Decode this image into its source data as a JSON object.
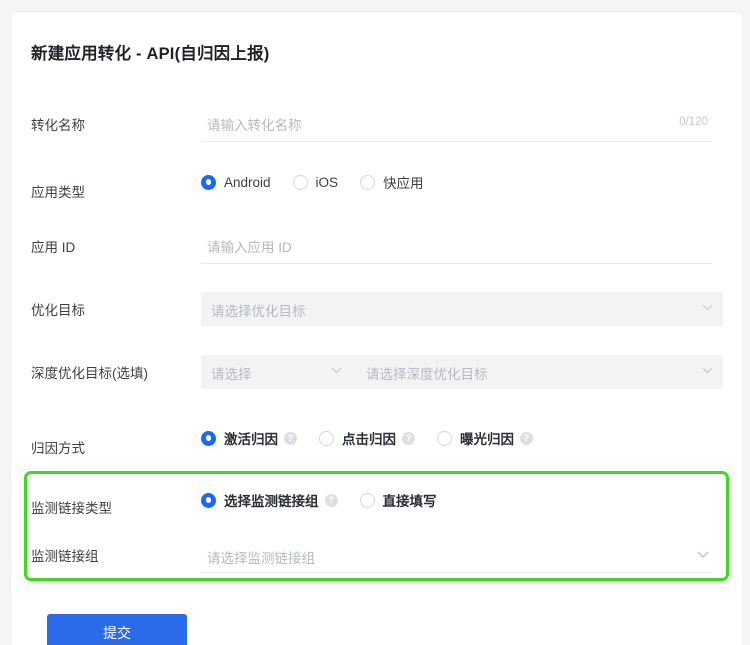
{
  "page": {
    "title": "新建应用转化 - API(自归因上报)",
    "accent_blue": "#1a66ff",
    "button_blue": "#2b6ae8",
    "highlight_green": "#3ddb1e"
  },
  "fields": {
    "conversion_name": {
      "label": "转化名称",
      "placeholder": "请输入转化名称",
      "value": "",
      "counter": "0/120"
    },
    "app_type": {
      "label": "应用类型",
      "options": [
        {
          "label": "Android",
          "checked": true
        },
        {
          "label": "iOS",
          "checked": false
        },
        {
          "label": "快应用",
          "checked": false
        }
      ]
    },
    "app_id": {
      "label": "应用 ID",
      "placeholder": "请输入应用 ID",
      "value": ""
    },
    "optimization_goal": {
      "label": "优化目标",
      "placeholder": "请选择优化目标",
      "value": "",
      "disabled": true
    },
    "deep_optimization_goal": {
      "label": "深度优化目标(选填)",
      "placeholder_type": "请选择",
      "placeholder_goal": "请选择深度优化目标",
      "disabled": true
    },
    "attribution_method": {
      "label": "归因方式",
      "options": [
        {
          "label": "激活归因",
          "checked": true,
          "help": "?"
        },
        {
          "label": "点击归因",
          "checked": false,
          "help": "?"
        },
        {
          "label": "曝光归因",
          "checked": false,
          "help": "?"
        }
      ]
    },
    "tracking_link_type": {
      "label": "监测链接类型",
      "options": [
        {
          "label": "选择监测链接组",
          "checked": true,
          "help": "?"
        },
        {
          "label": "直接填写",
          "checked": false
        }
      ]
    },
    "tracking_link_group": {
      "label": "监测链接组",
      "placeholder": "请选择监测链接组",
      "value": ""
    }
  },
  "actions": {
    "submit_label": "提交"
  }
}
